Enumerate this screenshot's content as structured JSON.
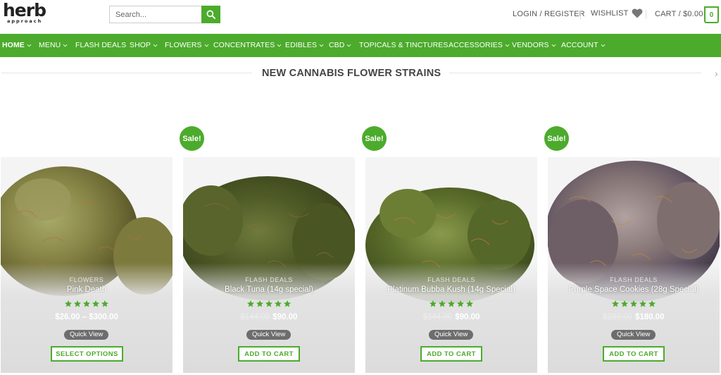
{
  "header": {
    "logo_main": "herb",
    "logo_sub": "approach",
    "search_placeholder": "Search...",
    "login_label": "LOGIN / REGISTER",
    "wishlist_label": "WISHLIST",
    "cart_label": "CART / $0.00",
    "cart_count": "0"
  },
  "nav": {
    "items": [
      {
        "label": "HOME"
      },
      {
        "label": "MENU"
      },
      {
        "label": "FLASH DEALS"
      },
      {
        "label": "SHOP"
      },
      {
        "label": "FLOWERS"
      },
      {
        "label": "CONCENTRATES"
      },
      {
        "label": "EDIBLES"
      },
      {
        "label": "CBD"
      },
      {
        "label": "TOPICALS & TINCTURES"
      },
      {
        "label": "ACCESSORIES"
      },
      {
        "label": "VENDORS"
      },
      {
        "label": "ACCOUNT"
      }
    ]
  },
  "section": {
    "title": "NEW CANNABIS FLOWER STRAINS"
  },
  "colors": {
    "accent": "#4cab2c"
  },
  "products": [
    {
      "category": "FLOWERS",
      "name": "Pink Death",
      "price": "$26.00 – $300.00",
      "old_price": "",
      "sale_label": "",
      "rating": 5,
      "quick_view": "Quick View",
      "button": "SELECT OPTIONS"
    },
    {
      "category": "FLASH DEALS",
      "name": "Black Tuna (14g special)",
      "price": "$90.00",
      "old_price": "$144.00",
      "sale_label": "Sale!",
      "rating": 5,
      "quick_view": "Quick View",
      "button": "ADD TO CART"
    },
    {
      "category": "FLASH DEALS",
      "name": "Platinum Bubba Kush (14g Special)",
      "price": "$90.00",
      "old_price": "$144.00",
      "sale_label": "Sale!",
      "rating": 5,
      "quick_view": "Quick View",
      "button": "ADD TO CART"
    },
    {
      "category": "FLASH DEALS",
      "name": "Purple Space Cookies (28g Special)",
      "price": "$180.00",
      "old_price": "$280.00",
      "sale_label": "Sale!",
      "rating": 5,
      "quick_view": "Quick View",
      "button": "ADD TO CART"
    }
  ]
}
